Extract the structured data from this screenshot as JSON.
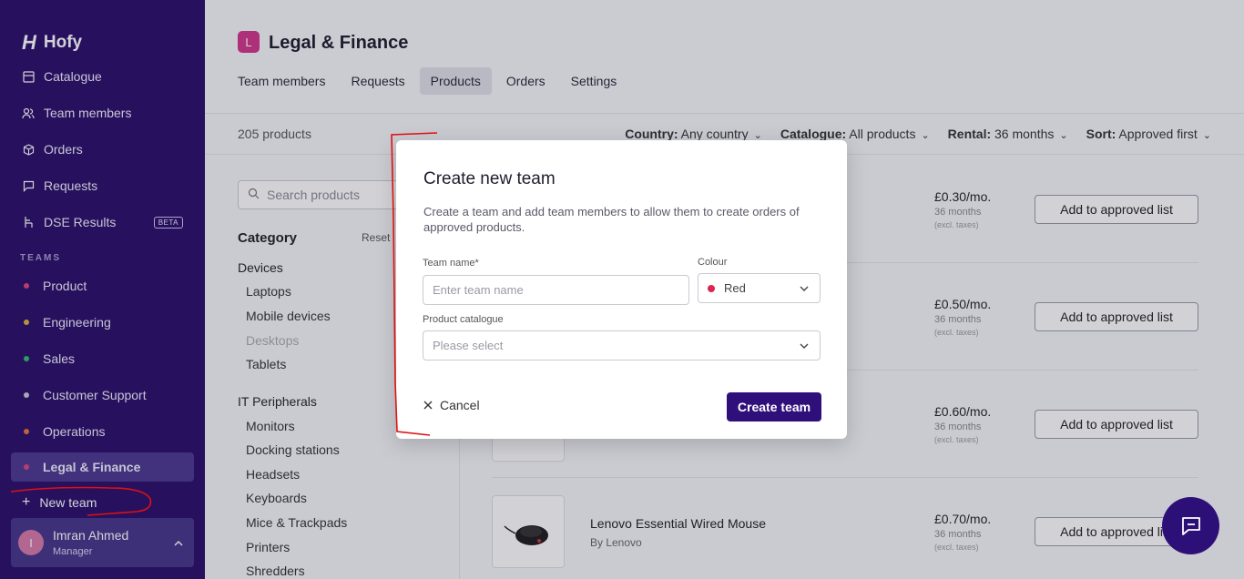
{
  "app": {
    "name": "Hofy"
  },
  "sidebar": {
    "items": [
      {
        "label": "Catalogue",
        "icon": "catalogue-icon"
      },
      {
        "label": "Team members",
        "icon": "people-icon"
      },
      {
        "label": "Orders",
        "icon": "box-icon"
      },
      {
        "label": "Requests",
        "icon": "chat-icon"
      },
      {
        "label": "DSE Results",
        "icon": "chair-icon",
        "badge": "BETA"
      }
    ],
    "teams_label": "TEAMS",
    "teams": [
      {
        "label": "Product",
        "color": "#e0457a"
      },
      {
        "label": "Engineering",
        "color": "#e0b13b"
      },
      {
        "label": "Sales",
        "color": "#2fbf71"
      },
      {
        "label": "Customer Support",
        "color": "#c9c9d6"
      },
      {
        "label": "Operations",
        "color": "#e8753b"
      },
      {
        "label": "Legal & Finance",
        "color": "#e0457a",
        "active": true
      }
    ],
    "new_team": "New team",
    "user": {
      "initial": "I",
      "name": "Imran Ahmed",
      "role": "Manager"
    }
  },
  "header": {
    "badge": "L",
    "title": "Legal & Finance",
    "tabs": [
      "Team members",
      "Requests",
      "Products",
      "Orders",
      "Settings"
    ],
    "active_tab": "Products"
  },
  "toolbar": {
    "count": "205 products",
    "filters": [
      {
        "label": "Country:",
        "value": "Any country"
      },
      {
        "label": "Catalogue:",
        "value": "All products"
      },
      {
        "label": "Rental:",
        "value": "36 months"
      },
      {
        "label": "Sort:",
        "value": "Approved first"
      }
    ]
  },
  "left_panel": {
    "search_placeholder": "Search products",
    "category_title": "Category",
    "reset": "Reset",
    "groups": [
      {
        "label": "Devices",
        "items": [
          "Laptops",
          "Mobile devices",
          "Desktops",
          "Tablets"
        ]
      },
      {
        "label": "IT Peripherals",
        "items": [
          "Monitors",
          "Docking stations",
          "Headsets",
          "Keyboards",
          "Mice & Trackpads",
          "Printers",
          "Shredders"
        ]
      }
    ]
  },
  "products": [
    {
      "name": "",
      "brand": "",
      "price": "£0.30/mo.",
      "period": "36 months",
      "excl": "(excl. taxes)",
      "action": "Add to approved list"
    },
    {
      "name": "",
      "brand": "",
      "price": "£0.50/mo.",
      "period": "36 months",
      "excl": "(excl. taxes)",
      "action": "Add to approved list"
    },
    {
      "name": "",
      "brand": "",
      "price": "£0.60/mo.",
      "period": "36 months",
      "excl": "(excl. taxes)",
      "action": "Add to approved list"
    },
    {
      "name": "Lenovo Essential Wired Mouse",
      "brand": "By Lenovo",
      "price": "£0.70/mo.",
      "period": "36 months",
      "excl": "(excl. taxes)",
      "action": "Add to approved list"
    }
  ],
  "modal": {
    "title": "Create new team",
    "description": "Create a team and add team members to allow them to create orders of approved products.",
    "team_name_label": "Team name*",
    "team_name_placeholder": "Enter team name",
    "colour_label": "Colour",
    "colour_value": "Red",
    "colour_swatch": "#e0244f",
    "catalogue_label": "Product catalogue",
    "catalogue_placeholder": "Please select",
    "cancel": "Cancel",
    "submit": "Create team"
  },
  "colors": {
    "sidebar_bg": "#2a0e6b",
    "primary": "#2f0f7a",
    "annotation": "#e01010"
  }
}
